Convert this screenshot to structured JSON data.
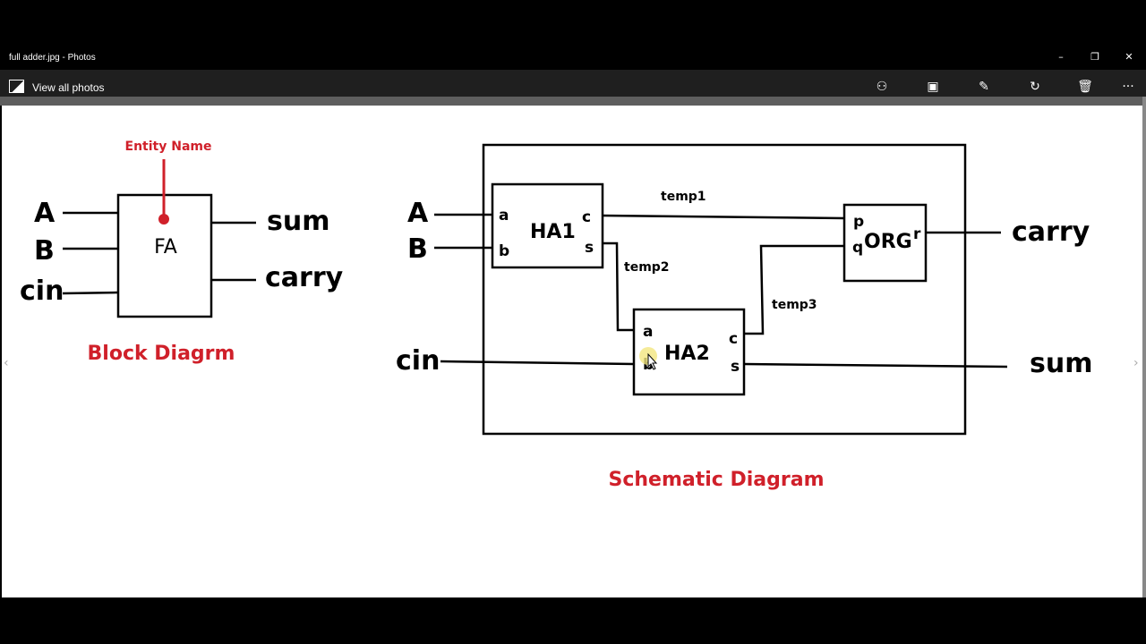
{
  "window": {
    "title": "full adder.jpg - Photos"
  },
  "toolbar": {
    "view_all": "View all photos",
    "icons": [
      "share-icon",
      "slideshow-icon",
      "edit-icon",
      "rotate-icon",
      "delete-icon",
      "more-icon"
    ]
  },
  "block": {
    "entity_label": "Entity Name",
    "box": "FA",
    "inputs": [
      "A",
      "B",
      "cin"
    ],
    "outputs": [
      "sum",
      "carry"
    ],
    "caption": "Block Diagrm"
  },
  "schematic": {
    "inputs": [
      "A",
      "B",
      "cin"
    ],
    "outputs": [
      "carry",
      "sum"
    ],
    "ha1": {
      "name": "HA1",
      "a": "a",
      "b": "b",
      "c": "c",
      "s": "s"
    },
    "ha2": {
      "name": "HA2",
      "a": "a",
      "b": "b",
      "c": "c",
      "s": "s"
    },
    "org": {
      "name": "ORG",
      "p": "p",
      "q": "q",
      "r": "r"
    },
    "signals": [
      "temp1",
      "temp2",
      "temp3"
    ],
    "caption": "Schematic Diagram"
  },
  "colors": {
    "accent": "#d0202a"
  }
}
